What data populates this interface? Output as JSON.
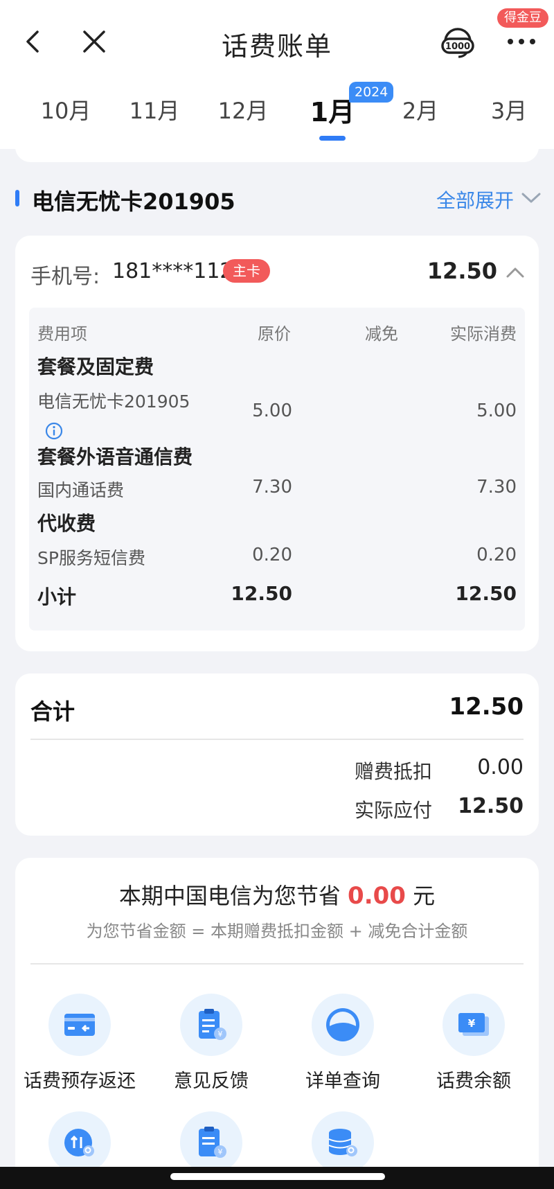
{
  "header": {
    "title": "话费账单",
    "back_icon": "chevron-left-icon",
    "close_icon": "close-icon",
    "service_icon": "10000-headset-icon",
    "more_icon": "more-dots-icon",
    "gold_badge": "得金豆"
  },
  "tabs": {
    "months": [
      "10月",
      "11月",
      "12月",
      "1月",
      "2月",
      "3月"
    ],
    "active_index": 3,
    "year_badge": "2024"
  },
  "section": {
    "title": "电信无忧卡201905",
    "expand_label": "全部展开"
  },
  "phone_card": {
    "label": "手机号:",
    "number": "181****1121",
    "badge": "主卡",
    "total": "12.50",
    "table": {
      "headers": [
        "费用项",
        "原价",
        "减免",
        "实际消费"
      ],
      "groups": [
        {
          "name": "套餐及固定费",
          "item": "电信无忧卡201905",
          "original": "5.00",
          "actual": "5.00"
        },
        {
          "name": "套餐外语音通信费",
          "item": "国内通话费",
          "original": "7.30",
          "actual": "7.30"
        },
        {
          "name": "代收费",
          "item": "SP服务短信费",
          "original": "0.20",
          "actual": "0.20"
        }
      ],
      "subtotal_label": "小计",
      "subtotal_original": "12.50",
      "subtotal_actual": "12.50"
    }
  },
  "total_card": {
    "label": "合计",
    "value": "12.50",
    "gift_label": "赠费抵扣",
    "gift_value": "0.00",
    "pay_label": "实际应付",
    "pay_value": "12.50"
  },
  "save_card": {
    "prefix": "本期中国电信为您节省",
    "amount": "0.00",
    "suffix": "元",
    "formula": "为您节省金额 = 本期赠费抵扣金额 + 减免合计金额",
    "functions": [
      {
        "label": "话费预存返还",
        "icon": "card-return-icon"
      },
      {
        "label": "意见反馈",
        "icon": "feedback-clipboard-icon"
      },
      {
        "label": "详单查询",
        "icon": "detail-query-icon"
      },
      {
        "label": "话费余额",
        "icon": "balance-yen-icon"
      }
    ],
    "more_icons": [
      "transfer-search-icon",
      "bill-clipboard-icon",
      "database-search-icon"
    ]
  },
  "colors": {
    "accent": "#2f7cf6",
    "red": "#f25a5a",
    "link": "#3a87e8"
  }
}
